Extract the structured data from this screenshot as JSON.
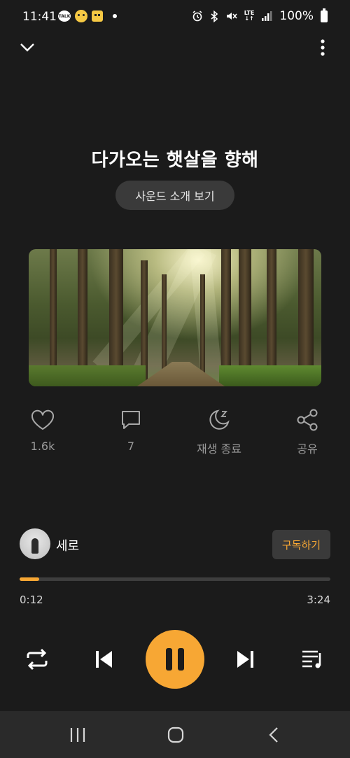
{
  "status_bar": {
    "time": "11:41",
    "talk_badge": "TALK",
    "lte": "LTE",
    "battery": "100%"
  },
  "header": {
    "collapse_icon": "chevron-down-icon",
    "menu_icon": "more-vertical-icon"
  },
  "track": {
    "title": "다가오는 햇살을 향해",
    "sound_intro_button": "사운드 소개 보기",
    "artwork": "forest-sunlight-image"
  },
  "actions": [
    {
      "icon": "heart-icon",
      "label": "1.6k"
    },
    {
      "icon": "comment-icon",
      "label": "7"
    },
    {
      "icon": "sleep-timer-icon",
      "label": "재생 종료"
    },
    {
      "icon": "share-icon",
      "label": "공유"
    }
  ],
  "artist": {
    "name": "세로",
    "subscribe_button": "구독하기"
  },
  "progress": {
    "current": "0:12",
    "total": "3:24",
    "fraction": 0.062
  },
  "controls": {
    "repeat_icon": "repeat-icon",
    "previous_icon": "skip-previous-icon",
    "play_pause_icon": "pause-icon",
    "next_icon": "skip-next-icon",
    "playlist_icon": "playlist-icon"
  },
  "colors": {
    "background": "#1b1b1b",
    "accent": "#f7a734",
    "button_bg": "#3a3a3a"
  }
}
